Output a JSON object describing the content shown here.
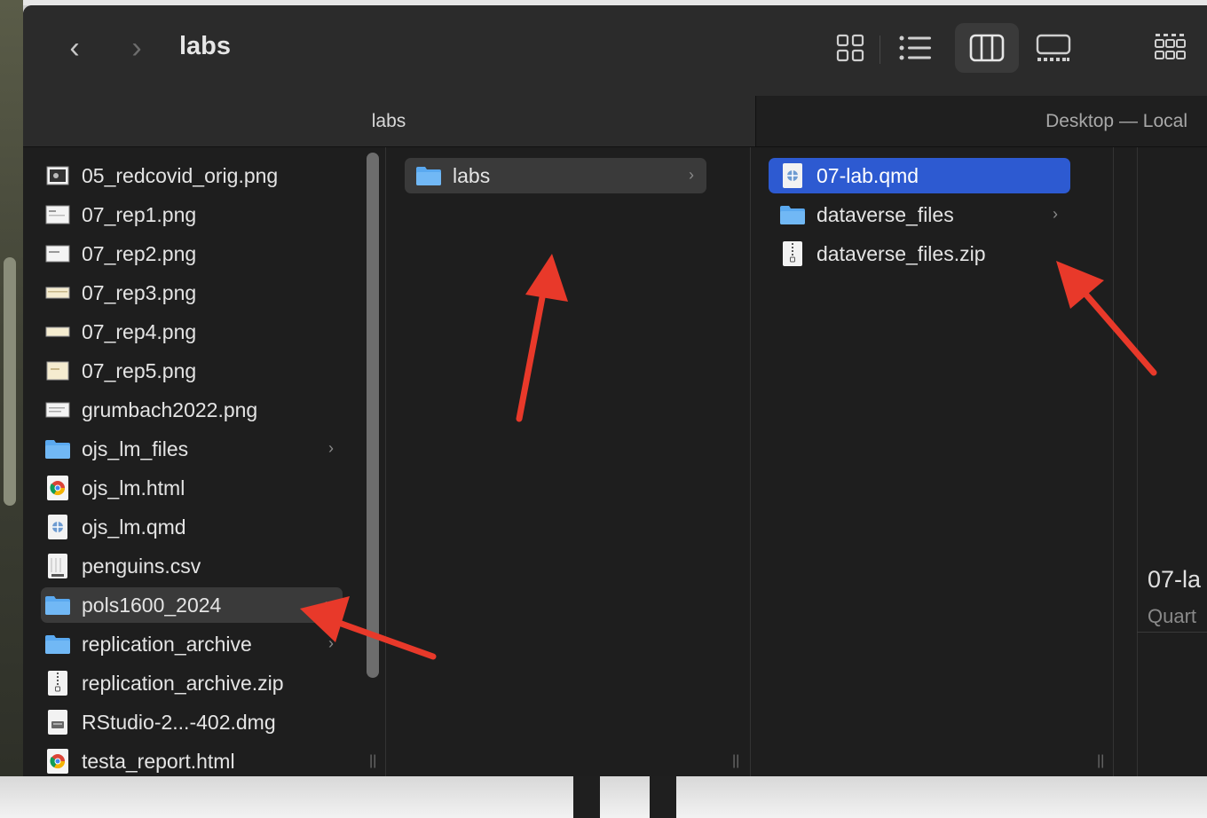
{
  "window": {
    "title": "labs"
  },
  "pathbar": {
    "current": "labs",
    "other": "Desktop — Local"
  },
  "toolbar": {
    "views": [
      {
        "name": "icon-view",
        "icon": "grid-icon",
        "active": false
      },
      {
        "name": "list-view",
        "icon": "list-icon",
        "active": false
      },
      {
        "name": "column-view",
        "icon": "columns-icon",
        "active": true
      },
      {
        "name": "gallery-view",
        "icon": "gallery-icon",
        "active": false
      }
    ],
    "group_icon": "group-icon"
  },
  "column1": {
    "items": [
      {
        "name": "05_redcovid_orig.png",
        "icon": "image-thumb-dark-icon"
      },
      {
        "name": "07_rep1.png",
        "icon": "image-thumb-icon"
      },
      {
        "name": "07_rep2.png",
        "icon": "image-thumb-icon"
      },
      {
        "name": "07_rep3.png",
        "icon": "image-thumb-tan-icon"
      },
      {
        "name": "07_rep4.png",
        "icon": "image-thumb-tan-icon"
      },
      {
        "name": "07_rep5.png",
        "icon": "image-thumb-tan-icon"
      },
      {
        "name": "grumbach2022.png",
        "icon": "image-thumb-icon"
      },
      {
        "name": "ojs_lm_files",
        "icon": "folder-icon"
      },
      {
        "name": "ojs_lm.html",
        "icon": "chrome-html-icon"
      },
      {
        "name": "ojs_lm.qmd",
        "icon": "qmd-document-icon"
      },
      {
        "name": "penguins.csv",
        "icon": "csv-document-icon"
      },
      {
        "name": "pols1600_2024",
        "icon": "folder-icon"
      },
      {
        "name": "replication_archive",
        "icon": "folder-icon"
      },
      {
        "name": "replication_archive.zip",
        "icon": "zip-document-icon"
      },
      {
        "name": "RStudio-2...-402.dmg",
        "icon": "dmg-disk-icon"
      },
      {
        "name": "testa_report.html",
        "icon": "chrome-html-icon"
      }
    ]
  },
  "column2": {
    "items": [
      {
        "name": "labs",
        "icon": "folder-icon"
      }
    ]
  },
  "column3": {
    "items": [
      {
        "name": "07-lab.qmd",
        "icon": "qmd-document-icon"
      },
      {
        "name": "dataverse_files",
        "icon": "folder-icon"
      },
      {
        "name": "dataverse_files.zip",
        "icon": "zip-document-icon"
      }
    ]
  },
  "preview": {
    "title": "07-la",
    "subtitle": "Quart"
  },
  "colors": {
    "selection": "#2d5ad1",
    "folder": "#5aa9f0",
    "arrow": "#e8392a"
  }
}
